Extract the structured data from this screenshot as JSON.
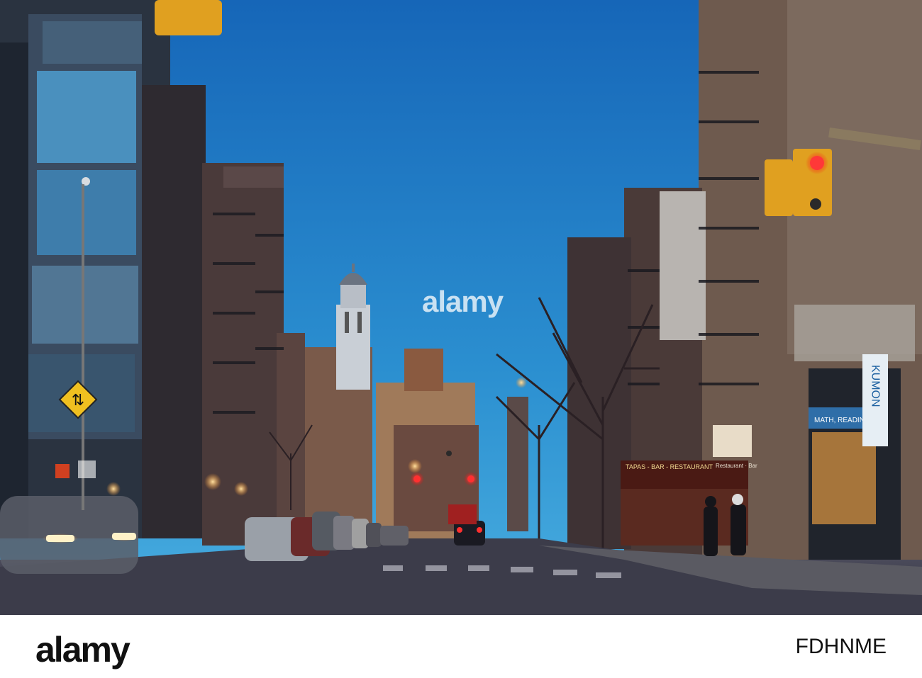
{
  "scene": {
    "description_colors": {
      "sky_top": "#1b6fbf",
      "sky_bottom": "#3aa0d8",
      "street": "#3a3a48",
      "light_red": "#ff2a2a",
      "light_amber": "#ffb347"
    }
  },
  "signs": {
    "shop_kumon": "KUMON",
    "shop_kumon_sub": "MATH, READING, S",
    "restaurant_awning": "TAPAS - BAR - RESTAURANT",
    "restaurant_sign": "Restaurant · Bar"
  },
  "watermark": {
    "center": "alamy",
    "tile": "alamy"
  },
  "footer": {
    "logo": "alamy",
    "image_id": "FDHNME"
  }
}
